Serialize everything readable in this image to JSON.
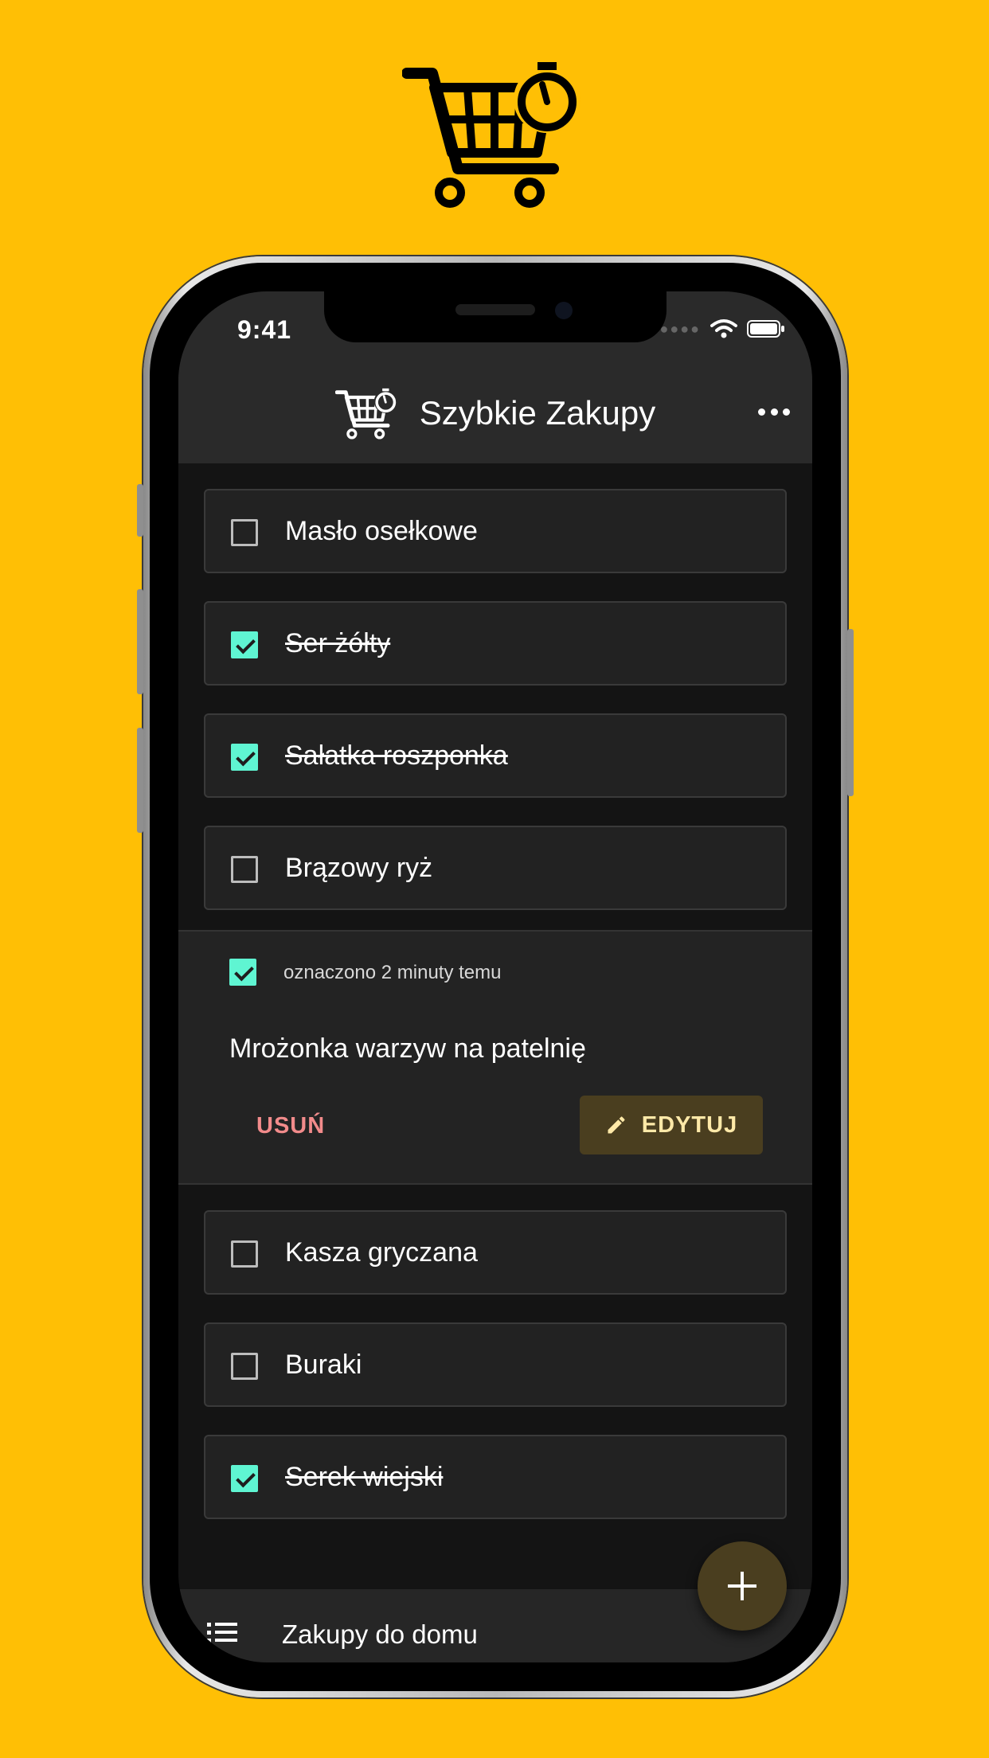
{
  "status_bar": {
    "time": "9:41"
  },
  "app_bar": {
    "title": "Szybkie Zakupy"
  },
  "items": [
    {
      "label": "Masło osełkowe",
      "checked": false
    },
    {
      "label": "Ser żółty",
      "checked": true
    },
    {
      "label": "Sałatka roszponka",
      "checked": true
    },
    {
      "label": "Brązowy ryż",
      "checked": false
    },
    {
      "label": "Kasza gryczana",
      "checked": false
    },
    {
      "label": "Buraki",
      "checked": false
    },
    {
      "label": "Serek wiejski",
      "checked": true
    }
  ],
  "expanded_item": {
    "checked": true,
    "checked_time": "oznaczono 2 minuty temu",
    "name": "Mrożonka warzyw na patelnię",
    "delete_label": "USUŃ",
    "edit_label": "EDYTUJ"
  },
  "bottom_bar": {
    "list_name": "Zakupy do domu"
  },
  "colors": {
    "background": "#FFBF05",
    "checkbox_checked": "#5FF5D2",
    "delete_text": "#F28B8B",
    "accent_button": "#4A3E1F"
  }
}
